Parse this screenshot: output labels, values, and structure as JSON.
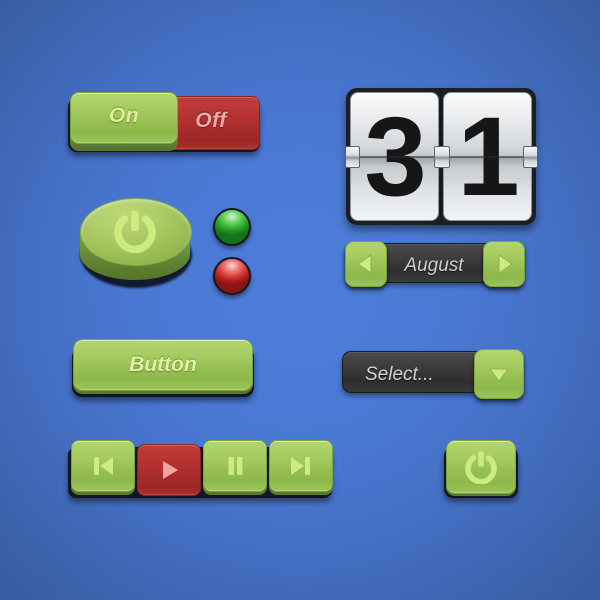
{
  "theme": {
    "background_center": "#4d7edc",
    "background_edge": "#37589b",
    "green_light": "#b3d46e",
    "green_dark": "#55742f",
    "green_text": "#dff29a",
    "red_light": "#c23b3b",
    "red_dark": "#9e2727",
    "red_text": "#f4a9a9",
    "dark_bar": "#3a3a3a",
    "dark_bar_text": "#c9cdd2",
    "metal_light": "#fbfbfc",
    "metal_dark": "#9aa0a6",
    "digit_color": "#161616",
    "led_green": "#27a82c",
    "led_red": "#cf2b2b"
  },
  "toggle": {
    "on_label": "On",
    "off_label": "Off",
    "state": "On"
  },
  "power_knob": {
    "icon": "power-icon"
  },
  "leds": [
    {
      "name": "led-green",
      "color": "#27a82c"
    },
    {
      "name": "led-red",
      "color": "#cf2b2b"
    }
  ],
  "flip_clock": {
    "left_digit": "3",
    "right_digit": "1",
    "value": "31"
  },
  "month_stepper": {
    "value": "August",
    "prev_icon": "triangle-left-icon",
    "next_icon": "triangle-right-icon"
  },
  "plain_button": {
    "label": "Button"
  },
  "select": {
    "placeholder": "Select...",
    "value": "",
    "arrow_icon": "triangle-down-icon"
  },
  "media": {
    "buttons": [
      {
        "name": "previous",
        "icon": "skip-previous-icon",
        "color": "green"
      },
      {
        "name": "play",
        "icon": "play-icon",
        "color": "red"
      },
      {
        "name": "pause",
        "icon": "pause-icon",
        "color": "green"
      },
      {
        "name": "next",
        "icon": "skip-next-icon",
        "color": "green"
      }
    ]
  },
  "power_button": {
    "icon": "power-icon"
  }
}
